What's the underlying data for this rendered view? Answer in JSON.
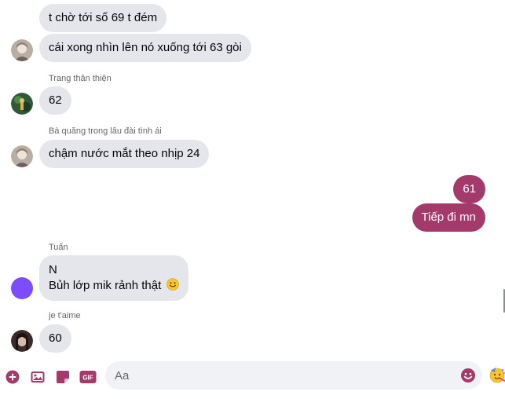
{
  "colors": {
    "accent": "#a33a6b",
    "incoming_bubble": "#e4e6eb",
    "composer_icon": "#a33a6b",
    "name_text": "#65676b"
  },
  "messages": [
    {
      "sender": "",
      "text": "t chờ tới số 69 t đém"
    },
    {
      "sender": "",
      "text": "cái xong nhìn lên nó xuống tới 63 gòi"
    },
    {
      "sender": "Trang thân thiện",
      "text": "62"
    },
    {
      "sender": "Bà quăng trong lâu đài tình ái",
      "text": "chậm nước mắt theo nhịp 24"
    },
    {
      "sender": "",
      "text": "61"
    },
    {
      "sender": "",
      "text": "Tiếp đi mn"
    },
    {
      "sender": "Tuấn",
      "line1": "N",
      "line2": "Bủh lớp mik rảnh thật"
    },
    {
      "sender": "je t'aime",
      "text": "60"
    }
  ],
  "composer": {
    "placeholder": "Aa",
    "gif_label": "GIF"
  },
  "icons": [
    "plus-circle-icon",
    "image-icon",
    "sticker-icon",
    "gif-icon",
    "smile-emoji-icon",
    "party-emoji-icon"
  ]
}
